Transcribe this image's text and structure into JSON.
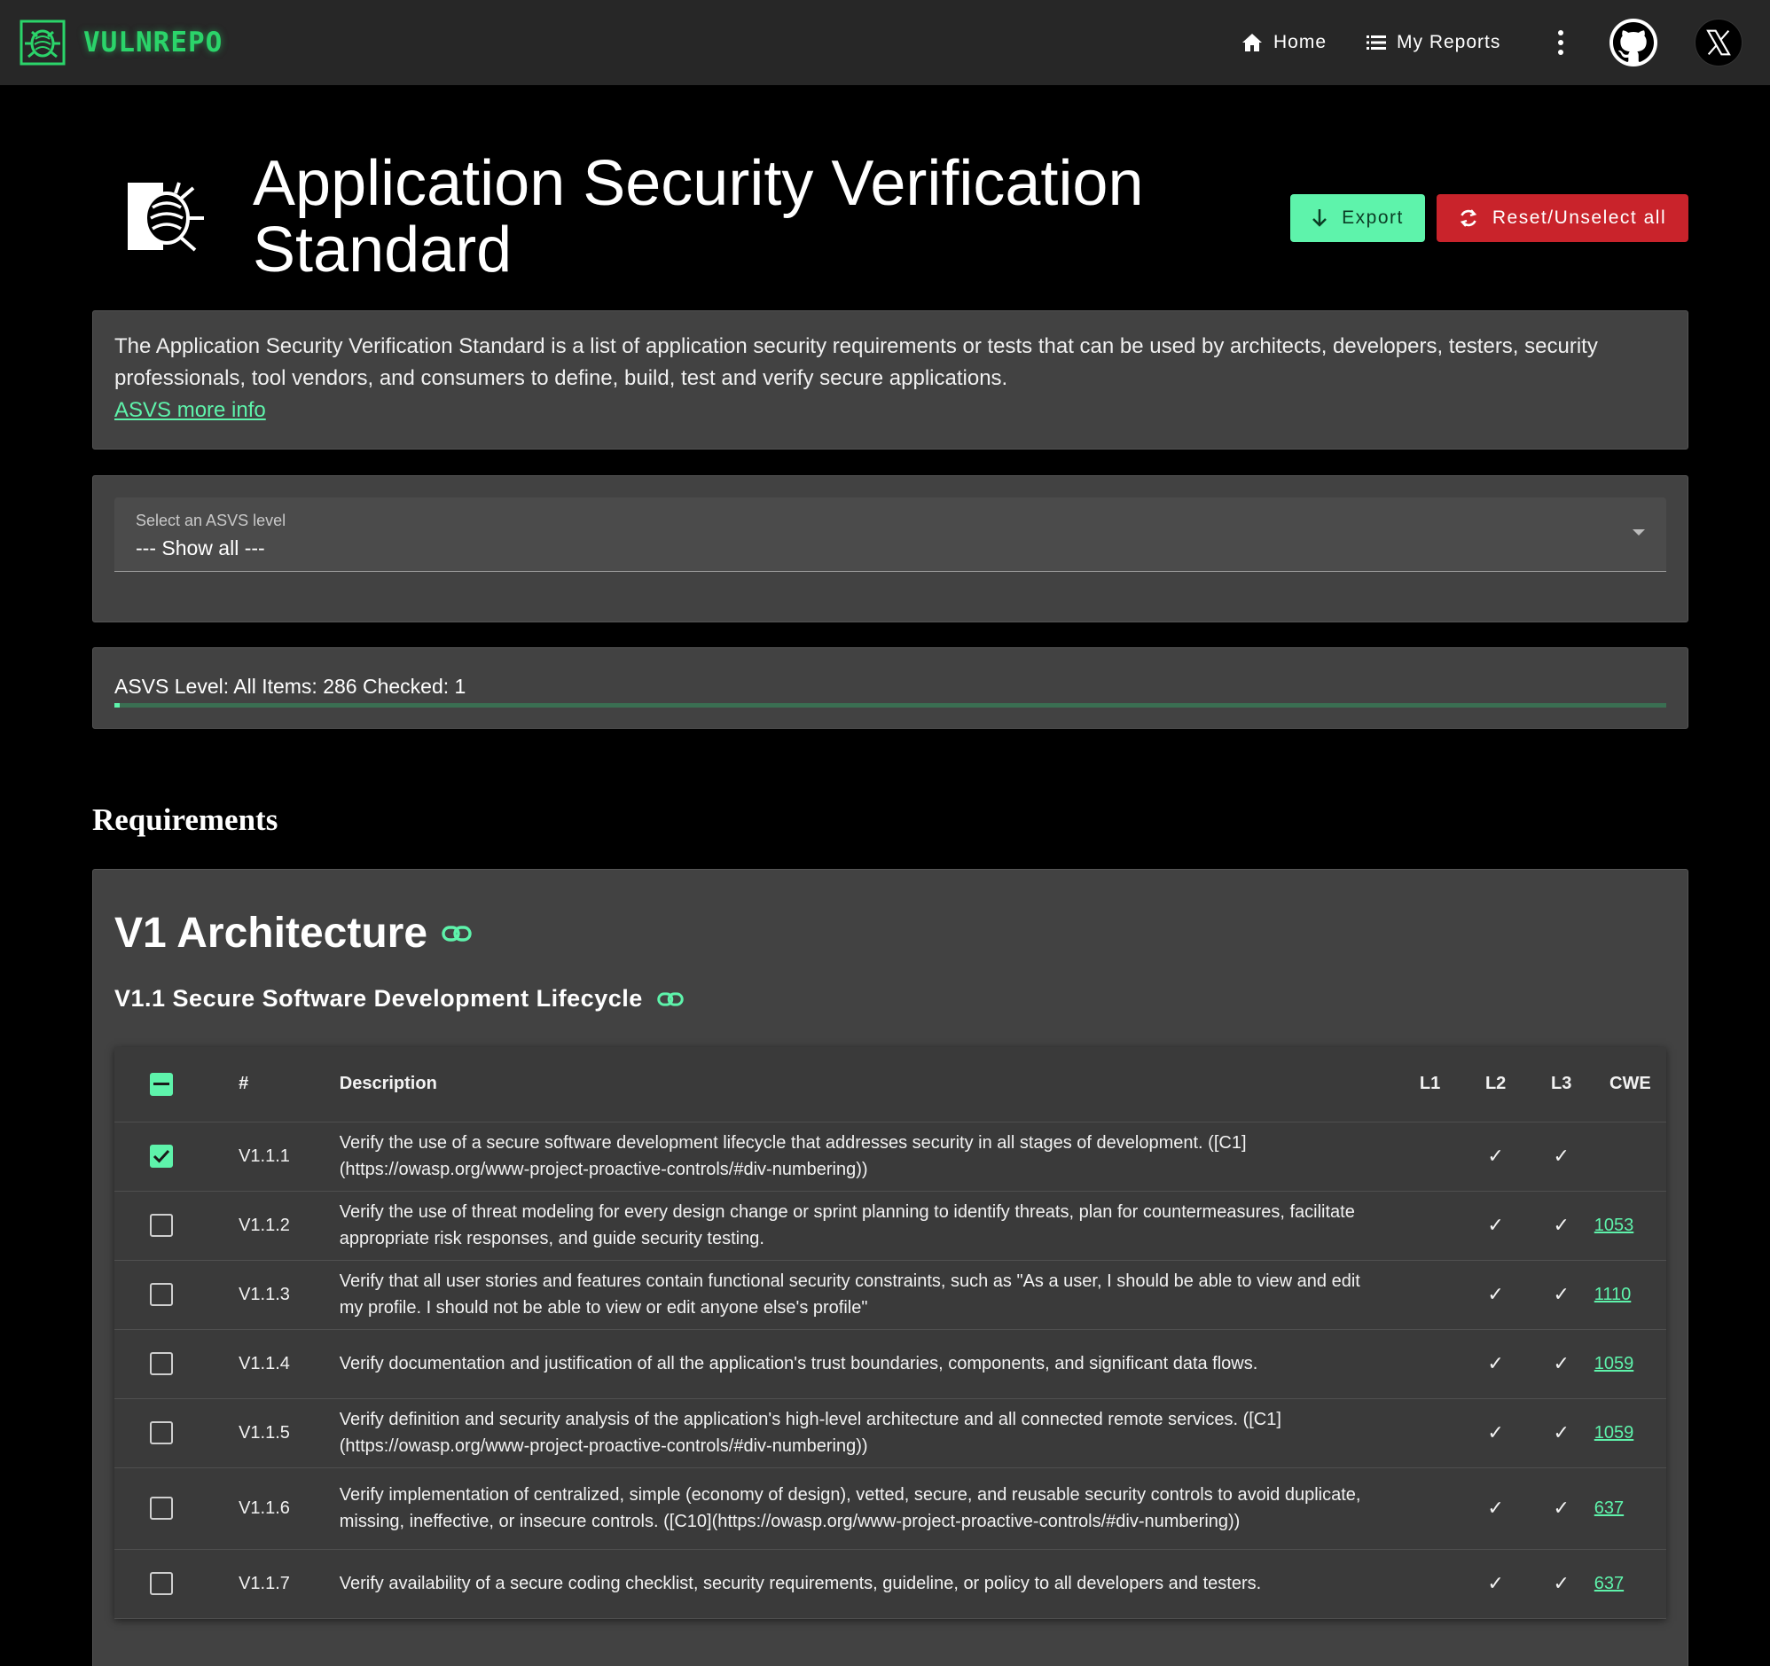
{
  "brand": {
    "name": "VULNREPO",
    "color": "#2bd46a",
    "logo_icon": "bug-icon"
  },
  "nav": {
    "home": "Home",
    "reports": "My Reports",
    "more_icon": "kebab-menu-icon",
    "github_icon": "github-icon",
    "x_icon": "x-logo-icon"
  },
  "header": {
    "title": "Application Security Verification Standard",
    "export_label": "Export",
    "reset_label": "Reset/Unselect all"
  },
  "colors": {
    "accent": "#5ef3ab",
    "danger": "#c9232b",
    "card": "#424242"
  },
  "intro": {
    "text": "The Application Security Verification Standard is a list of application security requirements or tests that can be used by architects, developers, testers, security professionals, tool vendors, and consumers to define, build, test and verify secure applications.",
    "link": "ASVS more info"
  },
  "level_select": {
    "label": "Select an ASVS level",
    "value": "--- Show all ---"
  },
  "progress": {
    "text": "ASVS Level: All Items: 286 Checked: 1",
    "checked": 1,
    "total": 286
  },
  "requirements": {
    "heading": "Requirements",
    "chapter": "V1 Architecture",
    "section": "V1.1 Secure Software Development Lifecycle",
    "columns": {
      "number": "#",
      "description": "Description",
      "l1": "L1",
      "l2": "L2",
      "l3": "L3",
      "cwe": "CWE"
    },
    "check_mark": "✓",
    "rows": [
      {
        "checked": true,
        "id": "V1.1.1",
        "description": "Verify the use of a secure software development lifecycle that addresses security in all stages of development. ([C1](https://owasp.org/www-project-proactive-controls/#div-numbering))",
        "l1": "",
        "l2": "✓",
        "l3": "✓",
        "cwe": ""
      },
      {
        "checked": false,
        "id": "V1.1.2",
        "description": "Verify the use of threat modeling for every design change or sprint planning to identify threats, plan for countermeasures, facilitate appropriate risk responses, and guide security testing.",
        "l1": "",
        "l2": "✓",
        "l3": "✓",
        "cwe": "1053"
      },
      {
        "checked": false,
        "id": "V1.1.3",
        "description": "Verify that all user stories and features contain functional security constraints, such as \"As a user, I should be able to view and edit my profile. I should not be able to view or edit anyone else's profile\"",
        "l1": "",
        "l2": "✓",
        "l3": "✓",
        "cwe": "1110"
      },
      {
        "checked": false,
        "id": "V1.1.4",
        "description": "Verify documentation and justification of all the application's trust boundaries, components, and significant data flows.",
        "l1": "",
        "l2": "✓",
        "l3": "✓",
        "cwe": "1059"
      },
      {
        "checked": false,
        "id": "V1.1.5",
        "description": "Verify definition and security analysis of the application's high-level architecture and all connected remote services. ([C1](https://owasp.org/www-project-proactive-controls/#div-numbering))",
        "l1": "",
        "l2": "✓",
        "l3": "✓",
        "cwe": "1059"
      },
      {
        "checked": false,
        "id": "V1.1.6",
        "description": "Verify implementation of centralized, simple (economy of design), vetted, secure, and reusable security controls to avoid duplicate, missing, ineffective, or insecure controls. ([C10](https://owasp.org/www-project-proactive-controls/#div-numbering))",
        "l1": "",
        "l2": "✓",
        "l3": "✓",
        "cwe": "637"
      },
      {
        "checked": false,
        "id": "V1.1.7",
        "description": "Verify availability of a secure coding checklist, security requirements, guideline, or policy to all developers and testers.",
        "l1": "",
        "l2": "✓",
        "l3": "✓",
        "cwe": "637"
      }
    ]
  }
}
